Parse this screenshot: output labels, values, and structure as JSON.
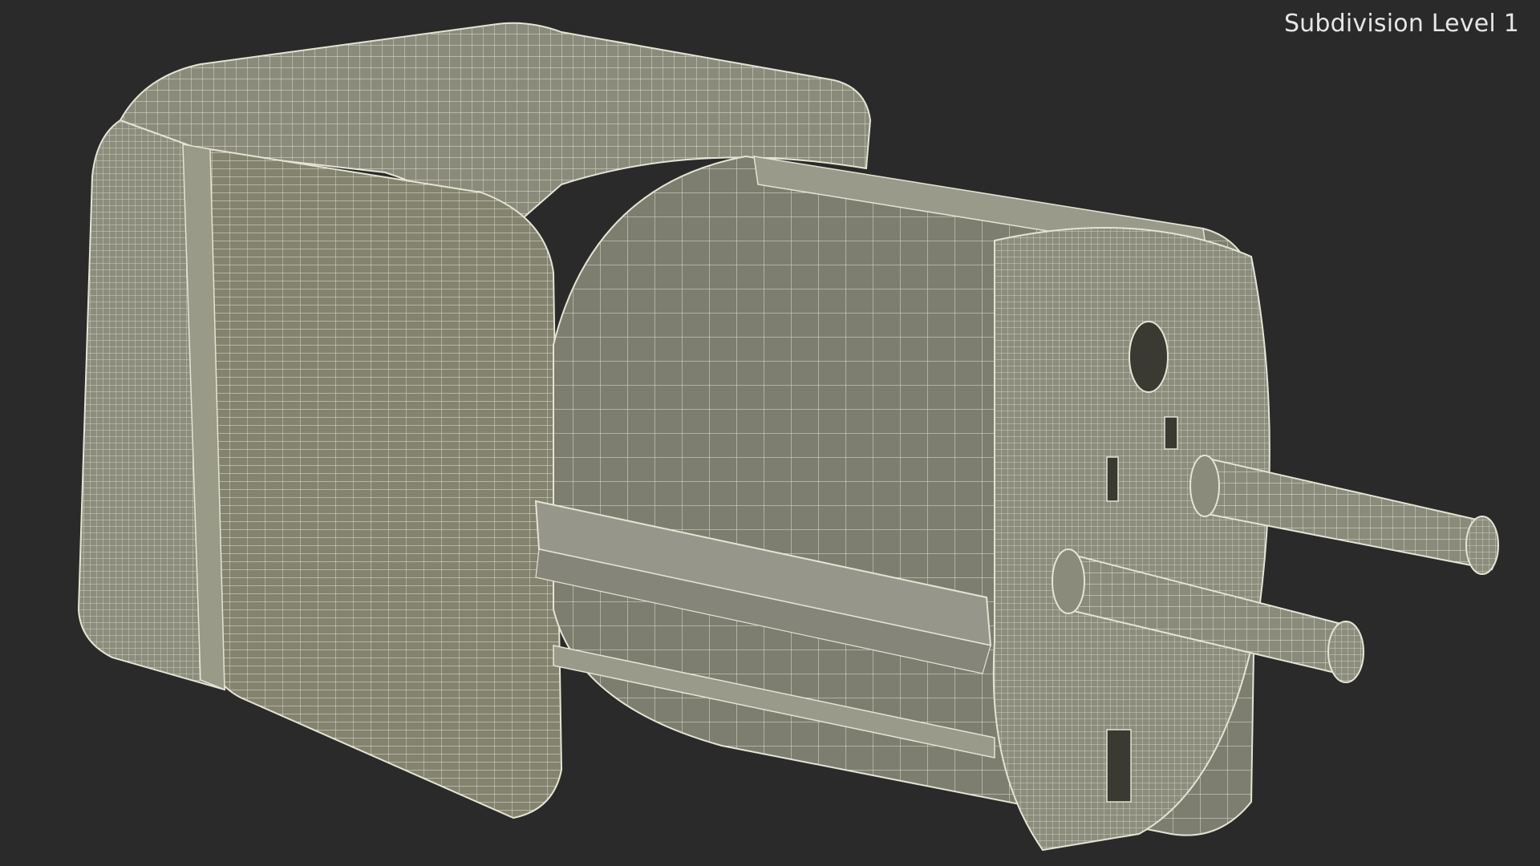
{
  "viewport": {
    "label": "Subdivision Level 1"
  },
  "render": {
    "subject": "plug-adapter-wireframe-render",
    "colors": {
      "background": "#2a2a2a",
      "surface": "#8b8b7c",
      "surface_dark": "#6e6e61",
      "wire": "#e4e4d4"
    }
  }
}
